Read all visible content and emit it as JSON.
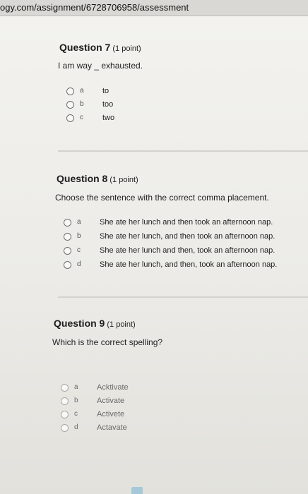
{
  "browser": {
    "url": "ogy.com/assignment/6728706958/assessment"
  },
  "questions": [
    {
      "title": "Question 7",
      "points": "(1 point)",
      "prompt": "I am way _ exhausted.",
      "options": [
        {
          "letter": "a",
          "text": "to"
        },
        {
          "letter": "b",
          "text": "too"
        },
        {
          "letter": "c",
          "text": "two"
        }
      ]
    },
    {
      "title": "Question 8",
      "points": "(1 point)",
      "prompt": "Choose the sentence with the correct comma placement.",
      "options": [
        {
          "letter": "a",
          "text": "She ate her lunch and then took an afternoon nap."
        },
        {
          "letter": "b",
          "text": "She ate her lunch, and then took an afternoon nap."
        },
        {
          "letter": "c",
          "text": "She ate her lunch and then, took an afternoon nap."
        },
        {
          "letter": "d",
          "text": "She ate her lunch, and then, took an afternoon nap."
        }
      ]
    },
    {
      "title": "Question 9",
      "points": "(1 point)",
      "prompt": "Which is the correct spelling?",
      "options": [
        {
          "letter": "a",
          "text": "Acktivate"
        },
        {
          "letter": "b",
          "text": "Activate"
        },
        {
          "letter": "c",
          "text": "Activete"
        },
        {
          "letter": "d",
          "text": "Actavate"
        }
      ]
    }
  ]
}
